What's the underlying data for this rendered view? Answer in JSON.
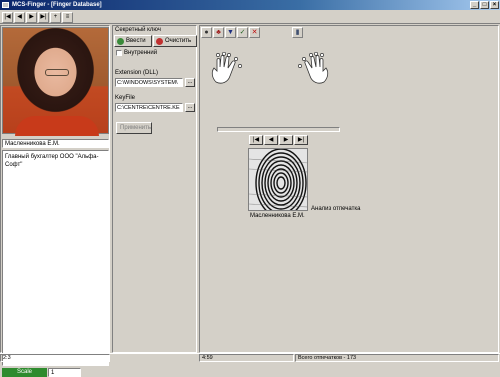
{
  "window": {
    "title": "MCS-Finger - [Finger Database]"
  },
  "toolbar": {
    "buttons": [
      "|◀",
      "◀",
      "▶",
      "▶|",
      "+",
      "≡"
    ]
  },
  "person": {
    "name": "Масленникова Е.М.",
    "notes": "Главный бухгалтер ООО \"Альфа-Софт\""
  },
  "left_status": {
    "label": "Scale",
    "value": "1"
  },
  "secret_key": {
    "header": "Секретный ключ",
    "enter_label": "Ввести",
    "clear_label": "Очистить",
    "internal_label": "Внутренний",
    "extension_label": "Extension (DLL)",
    "extension_value": "C:\\WINDOWS\\SYSTEM\\",
    "keyfile_label": "KeyFile",
    "keyfile_value": "C:\\CENTRE\\CENTRE.KE",
    "apply_label": "Применить"
  },
  "right_toolbar": {
    "icons": [
      "pin-icon",
      "users-icon",
      "down-arrow-icon",
      "check-icon",
      "delete-icon",
      "card-icon"
    ]
  },
  "scan": {
    "progress": 0.0,
    "nav": [
      "|◀",
      "◀",
      "▶",
      "▶|"
    ],
    "caption_name": "Масленникова Е.М.",
    "caption_analysis": "Анализ отпечатка"
  },
  "statusbar": {
    "left": "2:3",
    "time": "4:59",
    "total": "Всего отпечатков - 173"
  },
  "colors": {
    "title_start": "#0a246a",
    "title_end": "#a6caf0",
    "status_green": "#2e8b2e",
    "face": "#d4d0c8"
  }
}
